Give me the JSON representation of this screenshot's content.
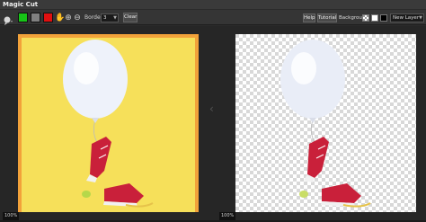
{
  "app": {
    "title": "Magic Cut"
  },
  "toolbar": {
    "tools": [
      {
        "name": "brush-tool",
        "icon": "brush-icon"
      },
      {
        "name": "hand-tool",
        "icon": "hand-icon",
        "glyph": "✋"
      },
      {
        "name": "zoom-in",
        "icon": "zoom-in-icon",
        "glyph": "⊕"
      },
      {
        "name": "zoom-out",
        "icon": "zoom-out-icon",
        "glyph": "⊖"
      }
    ],
    "colors": {
      "keep": "#17c417",
      "neutral": "#808080",
      "remove": "#e01010"
    },
    "border_label": "Border",
    "border_value": "3",
    "clear_label": "Clear",
    "help_label": "Help",
    "tutorial_label": "Tutorial",
    "background_label": "Background:",
    "layer_value": "New Layer"
  },
  "panels": {
    "left": {
      "zoom": "100%"
    },
    "right": {
      "zoom": "100%"
    }
  },
  "colors": {
    "canvas_yellow": "#f6e05a",
    "mark_orange": "#f2a23a"
  }
}
